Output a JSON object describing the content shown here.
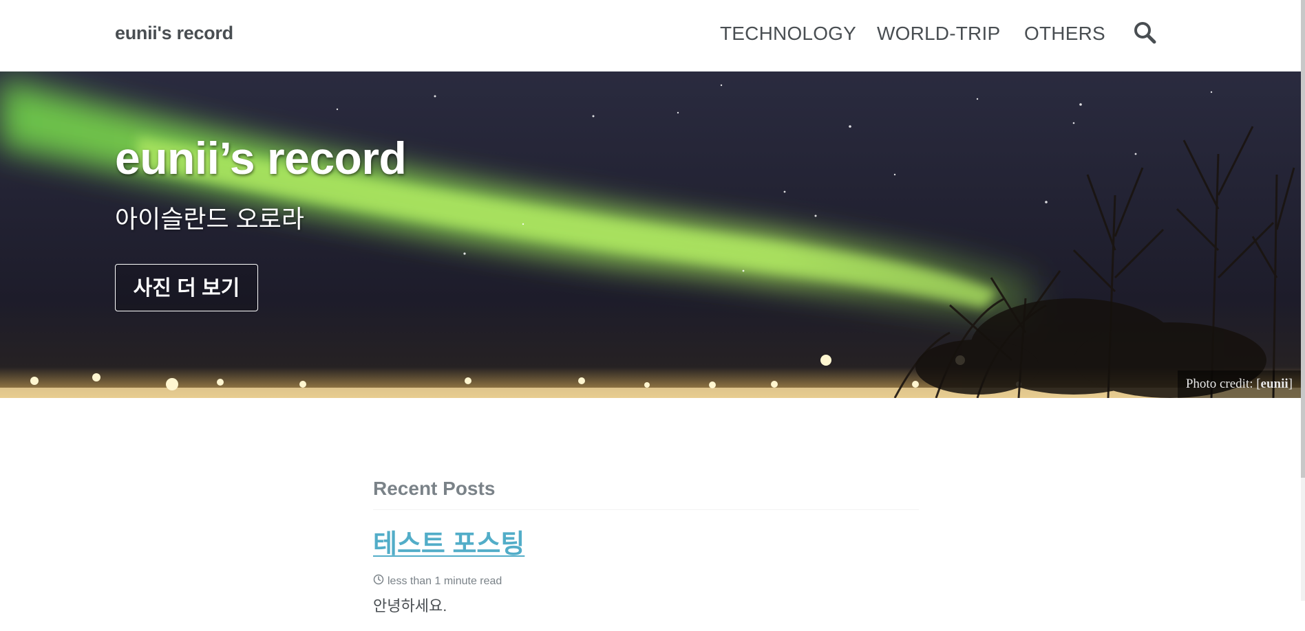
{
  "masthead": {
    "site_title": "eunii's record",
    "nav": [
      {
        "label": "TECHNOLOGY"
      },
      {
        "label": "WORLD-TRIP"
      },
      {
        "label": "OTHERS"
      }
    ],
    "search_icon": "search-icon"
  },
  "hero": {
    "title": "eunii’s record",
    "excerpt": "아이슬란드 오로라",
    "cta_label": "사진 더 보기",
    "credit_prefix": "Photo credit: [",
    "credit_name": "eunii",
    "credit_suffix": "]"
  },
  "recent": {
    "section_title": "Recent Posts",
    "posts": [
      {
        "title": "테스트 포스팅",
        "read_time": "less than 1 minute read",
        "excerpt": "안녕하세요."
      }
    ]
  },
  "colors": {
    "text": "#494e52",
    "muted": "#7a8288",
    "link": "#52adc8"
  }
}
